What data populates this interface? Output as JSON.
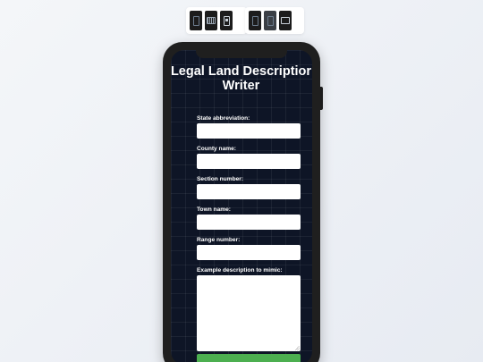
{
  "toolbar": {
    "device_buttons": [
      {
        "icon": "phone-portrait-icon"
      },
      {
        "icon": "tablet-icon"
      },
      {
        "icon": "phone-alt-icon"
      },
      {
        "icon": "phone-dark-icon"
      },
      {
        "icon": "phone-outline-icon"
      },
      {
        "icon": "desktop-icon"
      }
    ]
  },
  "app": {
    "title": "Legal Land Description Writer",
    "title_line1": "Legal Land Descriptior",
    "title_line2": "Writer"
  },
  "form": {
    "state_label": "State abbreviation:",
    "state_value": "",
    "county_label": "County name:",
    "county_value": "",
    "section_label": "Section number:",
    "section_value": "",
    "town_label": "Town name:",
    "town_value": "",
    "range_label": "Range number:",
    "range_value": "",
    "example_label": "Example description to mimic:",
    "example_value": ""
  },
  "colors": {
    "screen_background": "#0e1526",
    "submit_button": "#4caf50",
    "frame": "#1f1f1f"
  }
}
